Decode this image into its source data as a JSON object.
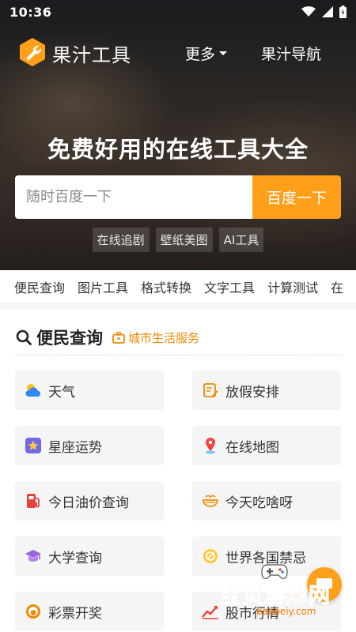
{
  "status_bar": {
    "time": "10:36"
  },
  "header": {
    "brand": "果汁工具",
    "more": "更多",
    "nav": "果汁导航"
  },
  "hero": {
    "headline": "免费好用的在线工具大全",
    "search_placeholder": "随时百度一下",
    "search_button": "百度一下",
    "chips": [
      "在线追剧",
      "壁纸美图",
      "AI工具"
    ]
  },
  "category_tabs": [
    "便民查询",
    "图片工具",
    "格式转换",
    "文字工具",
    "计算测试",
    "在"
  ],
  "section": {
    "title": "便民查询",
    "tag": "城市生活服务",
    "tools": [
      {
        "label": "天气",
        "icon": "weather-icon"
      },
      {
        "label": "放假安排",
        "icon": "holiday-icon"
      },
      {
        "label": "星座运势",
        "icon": "star-icon"
      },
      {
        "label": "在线地图",
        "icon": "map-pin-icon"
      },
      {
        "label": "今日油价查询",
        "icon": "fuel-icon"
      },
      {
        "label": "今天吃啥呀",
        "icon": "food-icon"
      },
      {
        "label": "大学查询",
        "icon": "graduation-cap-icon"
      },
      {
        "label": "世界各国禁忌",
        "icon": "ban-icon"
      },
      {
        "label": "彩票开奖",
        "icon": "lottery-icon"
      },
      {
        "label": "股市行情",
        "icon": "stock-chart-icon"
      }
    ]
  },
  "watermark": {
    "text": "宝贝游戏网",
    "url": "baobeiy.com"
  },
  "colors": {
    "accent": "#ff9f1a",
    "tag": "#f08a00",
    "card_bg": "#f5f5f5"
  }
}
